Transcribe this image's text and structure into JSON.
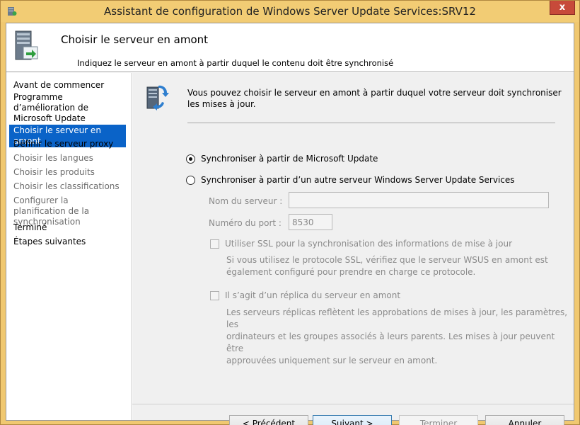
{
  "window": {
    "title": "Assistant de configuration de Windows Server Update Services:SRV12",
    "close_label": "x"
  },
  "header": {
    "title": "Choisir le serveur en amont",
    "subtitle": "Indiquez le serveur en amont à partir duquel le contenu doit être synchronisé"
  },
  "sidebar": {
    "items": [
      {
        "label": "Avant de commencer",
        "state": "normal"
      },
      {
        "label": "Programme d’amélioration de Microsoft Update",
        "state": "normal"
      },
      {
        "label": "Choisir le serveur en amont",
        "state": "active"
      },
      {
        "label": "Définir le serveur proxy",
        "state": "normal"
      },
      {
        "label": "Choisir les langues",
        "state": "disabled"
      },
      {
        "label": "Choisir les produits",
        "state": "disabled"
      },
      {
        "label": "Choisir les classifications",
        "state": "disabled"
      },
      {
        "label": "Configurer la planification de la synchronisation",
        "state": "disabled"
      },
      {
        "label": "Terminé",
        "state": "normal"
      },
      {
        "label": "Étapes suivantes",
        "state": "normal"
      }
    ]
  },
  "main": {
    "intro": "Vous pouvez choisir le serveur en amont à partir duquel votre serveur doit synchroniser les mises à jour.",
    "option_microsoft": {
      "label": "Synchroniser à partir de Microsoft Update",
      "checked": true
    },
    "option_wsus": {
      "label": "Synchroniser à partir d’un autre serveur Windows Server Update Services",
      "checked": false
    },
    "server_name": {
      "label": "Nom du serveur :",
      "value": ""
    },
    "port": {
      "label": "Numéro du port :",
      "value": "8530"
    },
    "ssl": {
      "label": "Utiliser SSL pour la synchronisation des informations de mise à jour",
      "checked": false,
      "desc_line1": "Si vous utilisez le protocole SSL, vérifiez que le serveur WSUS en amont est",
      "desc_line2": "également configuré pour prendre en charge ce protocole."
    },
    "replica": {
      "label": "Il s’agit d’un réplica du serveur en amont",
      "checked": false,
      "desc_line1": "Les serveurs réplicas reflètent les approbations de mises à jour, les paramètres, les",
      "desc_line2": "ordinateurs et les groupes associés à leurs parents. Les mises à jour peuvent être",
      "desc_line3": "approuvées uniquement sur le serveur en amont."
    }
  },
  "buttons": {
    "previous": "< Précédent",
    "next": "Suivant >",
    "finish": "Terminer",
    "cancel": "Annuler"
  }
}
